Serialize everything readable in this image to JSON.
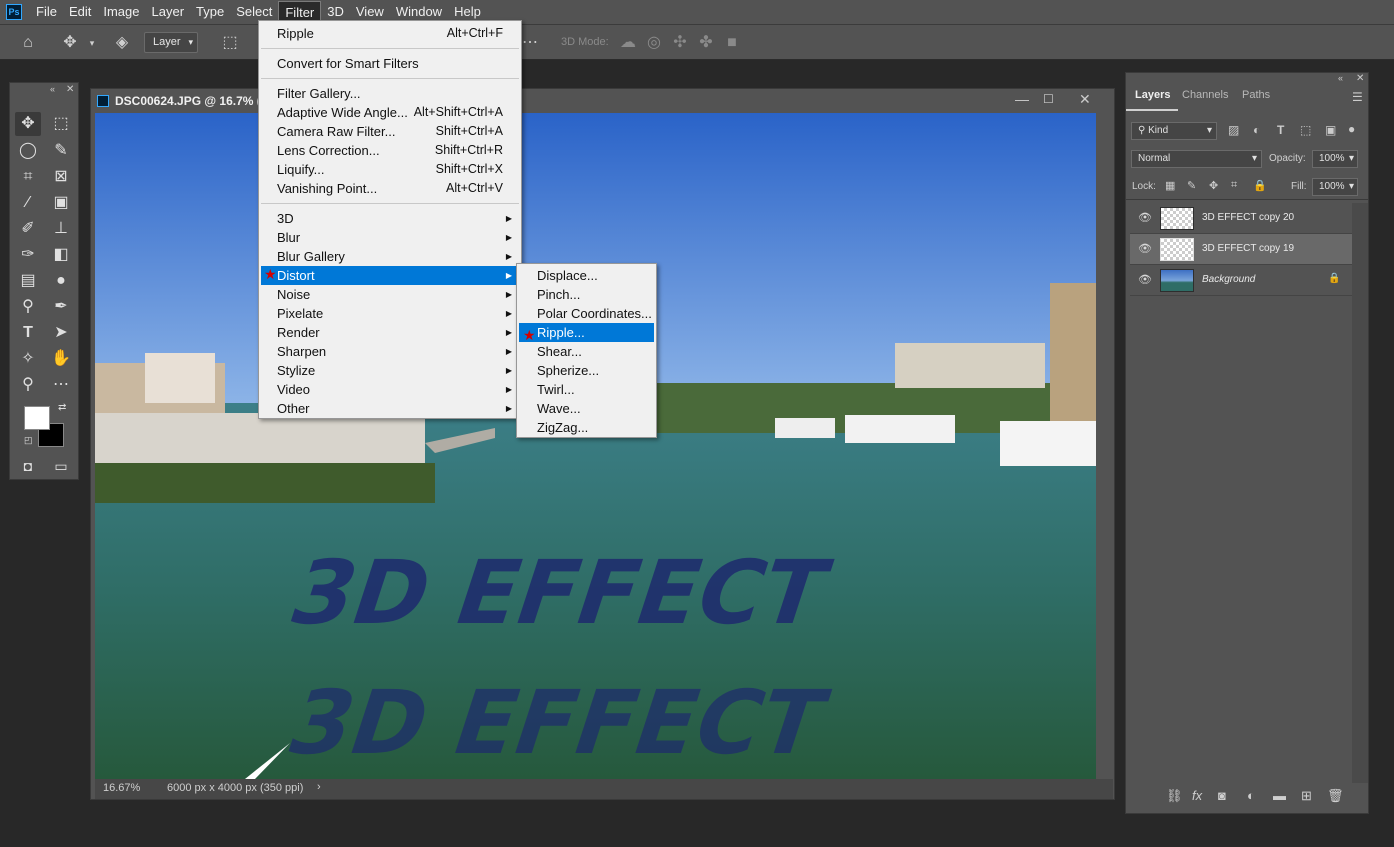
{
  "menubar": {
    "logo": "Ps",
    "items": [
      "File",
      "Edit",
      "Image",
      "Layer",
      "Type",
      "Select",
      "Filter",
      "3D",
      "View",
      "Window",
      "Help"
    ],
    "active": "Filter"
  },
  "options": {
    "layer_select": "Layer",
    "mode3d_label": "3D Mode:"
  },
  "document": {
    "title": "DSC00624.JPG @ 16.7% (3D",
    "zoom": "16.67%",
    "dimensions": "6000 px x 4000 px (350 ppi)"
  },
  "filter_menu": {
    "last_filter": {
      "label": "Ripple",
      "shortcut": "Alt+Ctrl+F"
    },
    "convert": "Convert for Smart Filters",
    "group1": [
      {
        "label": "Filter Gallery...",
        "shortcut": ""
      },
      {
        "label": "Adaptive Wide Angle...",
        "shortcut": "Alt+Shift+Ctrl+A"
      },
      {
        "label": "Camera Raw Filter...",
        "shortcut": "Shift+Ctrl+A"
      },
      {
        "label": "Lens Correction...",
        "shortcut": "Shift+Ctrl+R"
      },
      {
        "label": "Liquify...",
        "shortcut": "Shift+Ctrl+X"
      },
      {
        "label": "Vanishing Point...",
        "shortcut": "Alt+Ctrl+V"
      }
    ],
    "submenus": [
      "3D",
      "Blur",
      "Blur Gallery",
      "Distort",
      "Noise",
      "Pixelate",
      "Render",
      "Sharpen",
      "Stylize",
      "Video",
      "Other"
    ],
    "highlighted": "Distort"
  },
  "distort_submenu": {
    "items": [
      "Displace...",
      "Pinch...",
      "Polar Coordinates...",
      "Ripple...",
      "Shear...",
      "Spherize...",
      "Twirl...",
      "Wave...",
      "ZigZag..."
    ],
    "highlighted": "Ripple..."
  },
  "layers_panel": {
    "tabs": [
      "Layers",
      "Channels",
      "Paths"
    ],
    "active_tab": "Layers",
    "filter_kind": "Kind",
    "blend_mode": "Normal",
    "opacity_label": "Opacity:",
    "opacity": "100%",
    "lock_label": "Lock:",
    "fill_label": "Fill:",
    "fill": "100%",
    "layers": [
      {
        "name": "3D EFFECT copy 20",
        "selected": false
      },
      {
        "name": "3D EFFECT copy 19",
        "selected": true
      },
      {
        "name": "Background",
        "selected": false,
        "locked": true
      }
    ]
  },
  "canvas_text": {
    "main": "3D EFFECT",
    "color": "#1e2a6e"
  }
}
